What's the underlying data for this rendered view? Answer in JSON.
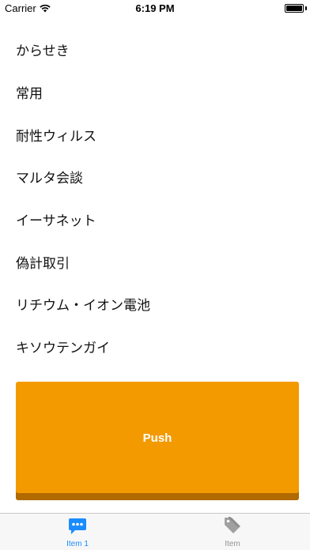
{
  "status_bar": {
    "carrier": "Carrier",
    "time": "6:19 PM"
  },
  "list": {
    "items": [
      "からせき",
      "常用",
      "耐性ウィルス",
      "マルタ会談",
      "イーサネット",
      "偽計取引",
      "リチウム・イオン電池",
      "キソウテンガイ"
    ]
  },
  "push_button": {
    "label": "Push",
    "color": "#f39a00"
  },
  "tab_bar": {
    "tabs": [
      {
        "label": "Item 1",
        "icon": "chat-bubble-icon",
        "active": true,
        "color": "#1a8cff"
      },
      {
        "label": "Item",
        "icon": "tag-icon",
        "active": false,
        "color": "#929292"
      }
    ]
  }
}
